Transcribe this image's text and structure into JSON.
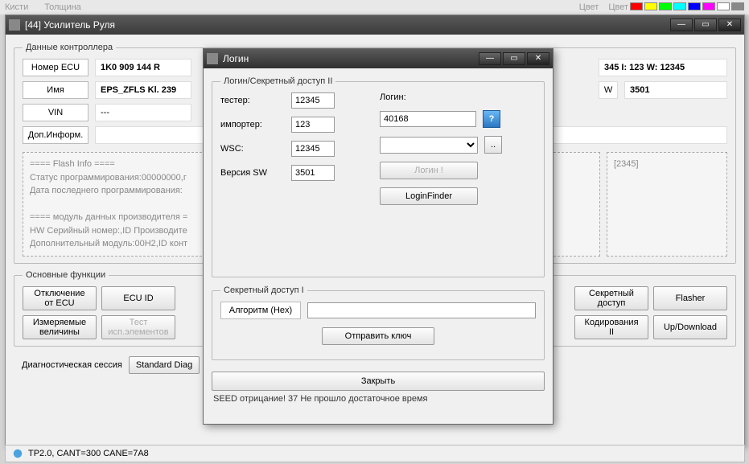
{
  "top_strip": {
    "label1": "Кисти",
    "label2": "Толщина",
    "label3": "Цвет",
    "label4": "Цвет"
  },
  "main_window": {
    "title": "[44] Усилитель Руля",
    "controller_data": {
      "legend": "Данные контроллера",
      "ecu_number_label": "Номер ECU",
      "ecu_number_value": "1K0 909 144 R",
      "name_label": "Имя",
      "name_value": "EPS_ZFLS Kl. 239",
      "vin_label": "VIN",
      "vin_value": "---",
      "addinfo_label": "Доп.Информ.",
      "right_value1": "345 I: 123 W: 12345",
      "right_label2": "W",
      "right_value2": "3501",
      "flash_text": "==== Flash Info ====\nСтатус программирования:00000000,г\nДата последнего программирования:\n\n==== модуль данных производителя =\nHW  Серийный номер:,ID Производите\nДополнительный модуль:00H2,ID конт",
      "flash_right": "[2345]"
    },
    "functions": {
      "legend": "Основные функции",
      "btn_disconnect": "Отключение от ECU",
      "btn_ecuid": "ECU ID",
      "btn_secret": "Секретный доступ",
      "btn_flasher": "Flasher",
      "btn_measured": "Измеряемые величины",
      "btn_test": "Тест исп.элементов",
      "btn_coding": "Кодирования II",
      "btn_updown": "Up/Download"
    },
    "diag": {
      "label": "Диагностическая сессия",
      "btn": "Standard Diag"
    },
    "status": "TP2.0, CANT=300 CANE=7A8"
  },
  "modal": {
    "title": "Логин",
    "section2": {
      "legend": "Логин/Секретный доступ II",
      "tester_label": "тестер:",
      "tester_value": "12345",
      "importer_label": "импортер:",
      "importer_value": "123",
      "wsc_label": "WSC:",
      "wsc_value": "12345",
      "swver_label": "Версия SW",
      "swver_value": "3501",
      "login_label": "Логин:",
      "login_value": "40168",
      "btn_login": "Логин !",
      "btn_loginfinder": "LoginFinder"
    },
    "section1": {
      "legend": "Секретный доступ I",
      "algo_label": "Алгоритм (Hex)",
      "btn_send": "Отправить ключ"
    },
    "close_btn": "Закрыть",
    "seed_msg": "SEED отрицание! 37 Не прошло достаточное время"
  }
}
